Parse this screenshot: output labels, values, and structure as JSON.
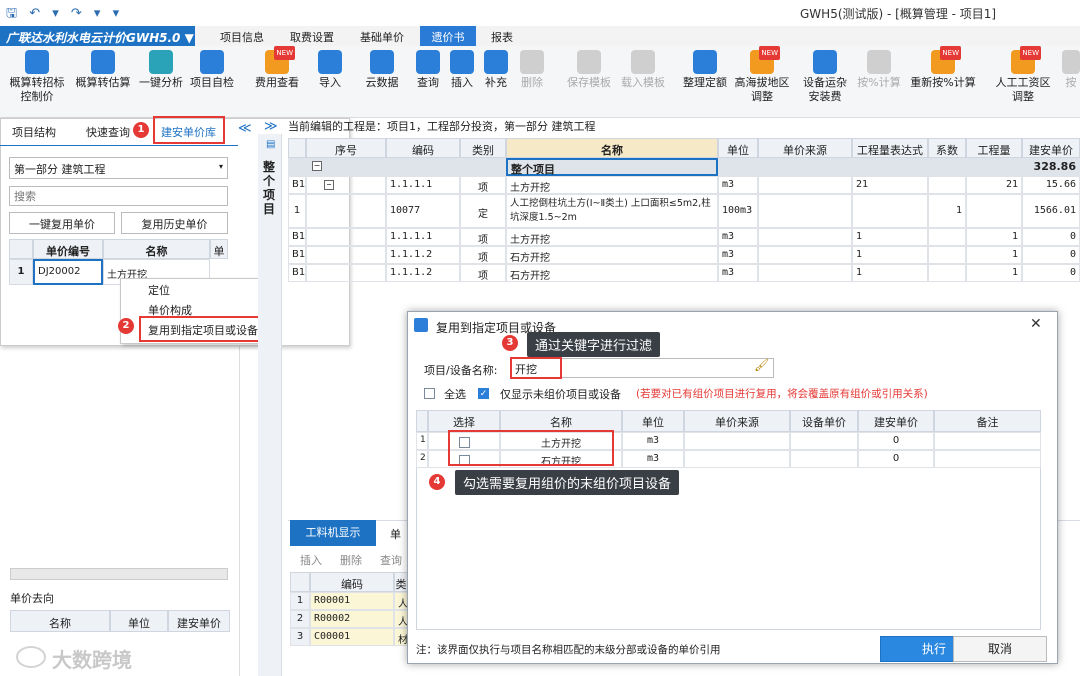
{
  "window": {
    "title": "GWH5(测试版) - [概算管理 - 项目1]",
    "app_name": "广联达水利水电云计价GWH5.0",
    "app_name_arrow": "▼"
  },
  "quick_access": "🖫 ↶ ▾ ↷ ▾ ▾",
  "menus": [
    "项目信息",
    "取费设置",
    "基础单价",
    "遗价书",
    "报表"
  ],
  "ribbon": [
    {
      "label": "概算转招标\n控制价",
      "icon": "doc-convert-icon"
    },
    {
      "label": "概算转估算",
      "icon": "calc-icon"
    },
    {
      "label": "一键分析",
      "icon": "analysis-icon"
    },
    {
      "label": "项目自检",
      "icon": "check-icon"
    },
    {
      "label": "费用查看",
      "icon": "view-icon"
    },
    {
      "label": "导入",
      "icon": "import-icon"
    },
    {
      "label": "云数据",
      "icon": "cloud-icon"
    },
    {
      "label": "查询",
      "icon": "search-icon"
    },
    {
      "label": "插入",
      "icon": "insert-icon"
    },
    {
      "label": "补充",
      "icon": "add-icon"
    },
    {
      "label": "删除",
      "icon": "trash-icon"
    },
    {
      "label": "保存模板",
      "icon": "save-template-icon"
    },
    {
      "label": "载入模板",
      "icon": "load-template-icon"
    },
    {
      "label": "整理定额",
      "icon": "organize-icon"
    },
    {
      "label": "高海拔地区\n调整",
      "icon": "altitude-icon"
    },
    {
      "label": "设备运杂\n安装费",
      "icon": "truck-icon"
    },
    {
      "label": "按%计算",
      "icon": "percent-icon"
    },
    {
      "label": "重新按%计算",
      "icon": "recalc-icon"
    },
    {
      "label": "人工工资区\n调整",
      "icon": "wage-icon"
    },
    {
      "label": "按",
      "icon": "more-icon"
    }
  ],
  "ribbon_badge_new": "NEW",
  "left": {
    "tabs": [
      "项目结构",
      "快速查询",
      "建安单价库"
    ],
    "collapse_glyph": "≪",
    "expand_glyph": "≫",
    "section_select": "第一部分 建筑工程",
    "search_placeholder": "搜索",
    "btn_reuse": "一键复用单价",
    "btn_history": "复用历史单价",
    "grid_headers": [
      "单价编号",
      "名称",
      "单"
    ],
    "grid_rows": [
      {
        "idx": "1",
        "code": "DJ20002",
        "name": "土方开挖"
      }
    ],
    "flow_title": "单价去向",
    "flow_headers": [
      "名称",
      "单位",
      "建安单价"
    ]
  },
  "context_menu": [
    "定位",
    "单价构成",
    "复用到指定项目或设备"
  ],
  "steps": [
    "1",
    "2",
    "3",
    "4"
  ],
  "side_label": "整个项目",
  "current_project": "当前编辑的工程是：项目1，工程部分投资，第一部分 建筑工程",
  "main_table": {
    "headers": [
      "序号",
      "编码",
      "类别",
      "名称",
      "单位",
      "单价来源",
      "工程量表达式",
      "系数",
      "工程量",
      "建安单价"
    ],
    "summary": {
      "name": "整个项目",
      "price": "328.86"
    },
    "rows": [
      {
        "lvl": "B1",
        "seq": "⊟",
        "code": "1.1.1.1",
        "cat": "项",
        "name": "土方开挖",
        "unit": "m3",
        "expr": "21",
        "coef": "",
        "qty": "21",
        "price": "15.66"
      },
      {
        "lvl": "1",
        "seq": "",
        "code": "10077",
        "cat": "定",
        "name": "人工挖倒柱坑土方(Ⅰ~Ⅱ类土) 上口面积≤5m2,柱坑深度1.5~2m",
        "unit": "100m3",
        "expr": "",
        "coef": "1",
        "qty": "",
        "price": "1566.01"
      },
      {
        "lvl": "B1",
        "seq": "",
        "code": "1.1.1.1",
        "cat": "项",
        "name": "土方开挖",
        "unit": "m3",
        "expr": "1",
        "coef": "",
        "qty": "1",
        "price": "0"
      },
      {
        "lvl": "B1",
        "seq": "",
        "code": "1.1.1.2",
        "cat": "项",
        "name": "石方开挖",
        "unit": "m3",
        "expr": "1",
        "coef": "",
        "qty": "1",
        "price": "0"
      },
      {
        "lvl": "B1",
        "seq": "",
        "code": "1.1.1.2",
        "cat": "项",
        "name": "石方开挖",
        "unit": "m3",
        "expr": "1",
        "coef": "",
        "qty": "1",
        "price": "0"
      }
    ]
  },
  "bottom": {
    "tabs": [
      "工料机显示",
      "单"
    ],
    "tools": [
      "插入",
      "删除",
      "查询"
    ],
    "headers": [
      "编码",
      "类"
    ],
    "rows": [
      {
        "idx": "1",
        "code": "R00001",
        "cat": "人"
      },
      {
        "idx": "2",
        "code": "R00002",
        "cat": "人"
      },
      {
        "idx": "3",
        "code": "C00001",
        "cat": "材"
      }
    ]
  },
  "dialog": {
    "title": "复用到指定项目或设备",
    "close": "✕",
    "field_label": "项目/设备名称:",
    "field_value": "开挖",
    "brush": "🖌",
    "select_all": "全选",
    "only_unpriced": "仅显示未组价项目或设备",
    "warning": "(若要对已有组价项目进行复用，将会覆盖原有组价或引用关系)",
    "headers": [
      "选择",
      "名称",
      "单位",
      "单价来源",
      "设备单价",
      "建安单价",
      "备注"
    ],
    "rows": [
      {
        "idx": "1",
        "name": "土方开挖",
        "unit": "m3",
        "price": "0"
      },
      {
        "idx": "2",
        "name": "石方开挖",
        "unit": "m3",
        "price": "0"
      }
    ],
    "note": "注：该界面仅执行与项目名称相匹配的末级分部或设备的单价引用",
    "execute": "执行",
    "cancel": "取消"
  },
  "tips": {
    "step3": "通过关键字进行过滤",
    "step4": "勾选需要复用组价的末组价项目设备"
  },
  "watermark": "大数跨境",
  "colors": {
    "accent": "#2a7bd5",
    "red": "#e53935",
    "tip_bg": "#3a3f46"
  }
}
